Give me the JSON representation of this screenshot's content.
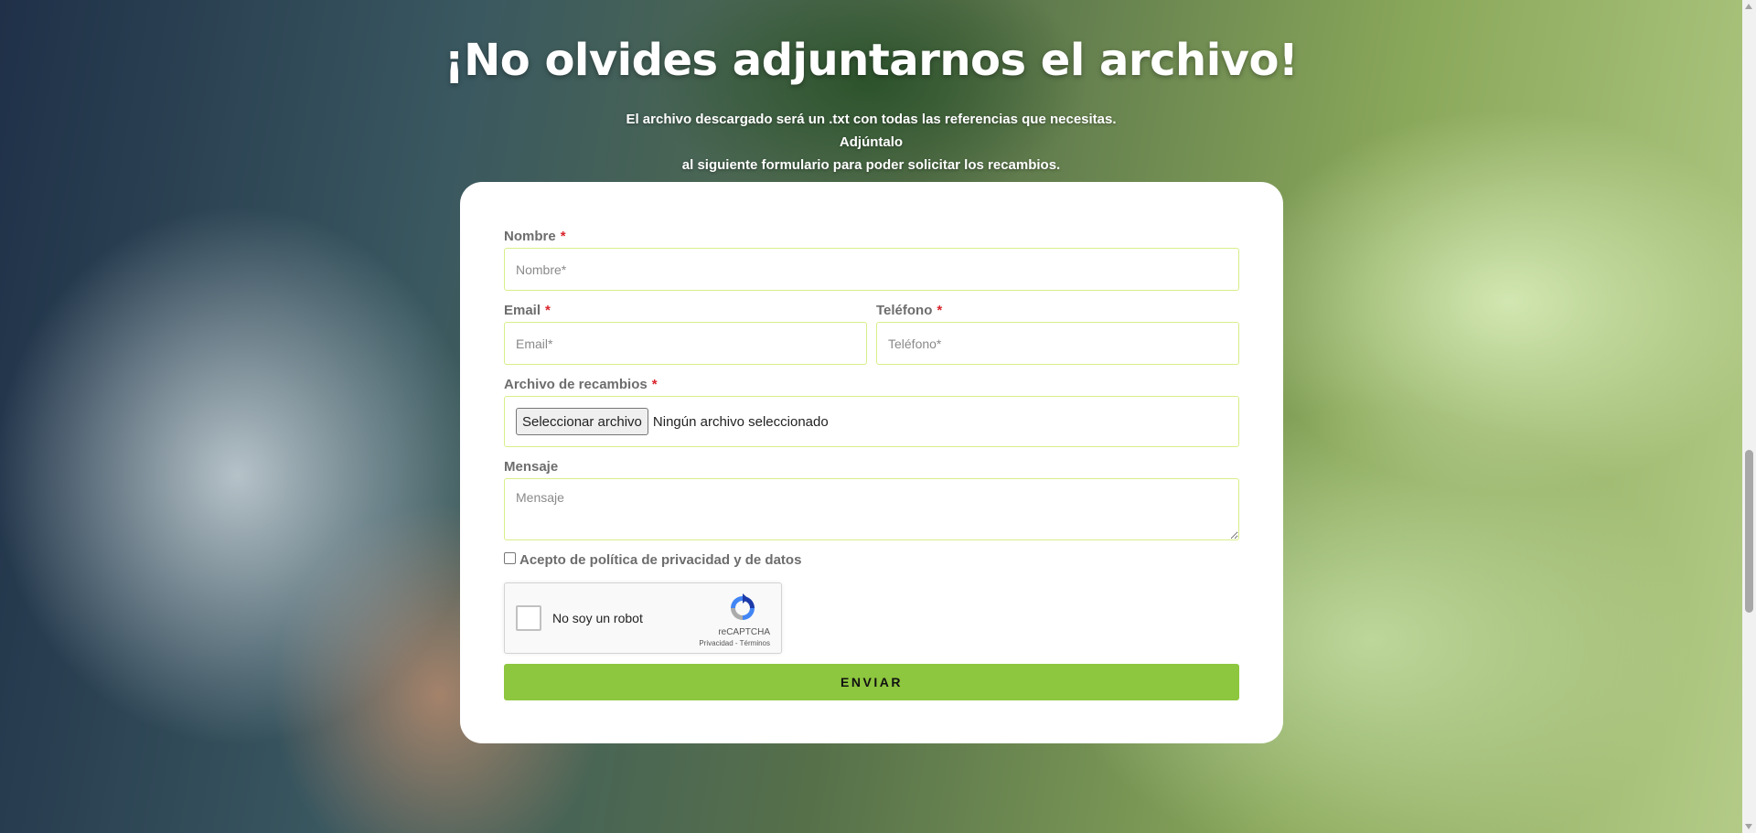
{
  "header": {
    "title": "¡No olvides adjuntarnos el archivo!",
    "subtitle_line1": "El archivo descargado será un .txt con todas las referencias que necesitas. Adjúntalo",
    "subtitle_line2": "al siguiente formulario para poder solicitar los recambios."
  },
  "form": {
    "nombre": {
      "label": "Nombre",
      "required_mark": "*",
      "placeholder": "Nombre*"
    },
    "email": {
      "label": "Email",
      "required_mark": "*",
      "placeholder": "Email*"
    },
    "telefono": {
      "label": "Teléfono",
      "required_mark": "*",
      "placeholder": "Teléfono*"
    },
    "archivo": {
      "label": "Archivo de recambios",
      "required_mark": "*",
      "button_label": "Seleccionar archivo",
      "status": "Ningún archivo seleccionado"
    },
    "mensaje": {
      "label": "Mensaje",
      "placeholder": "Mensaje"
    },
    "privacy": {
      "label": "Acepto de política de privacidad y de datos",
      "checked": false
    },
    "recaptcha": {
      "label": "No soy un robot",
      "brand": "reCAPTCHA",
      "links": "Privacidad - Términos"
    },
    "submit_label": "ENVIAR"
  },
  "colors": {
    "accent": "#8dc63f",
    "input_border": "#d7ee8a",
    "required": "#d9242c"
  }
}
